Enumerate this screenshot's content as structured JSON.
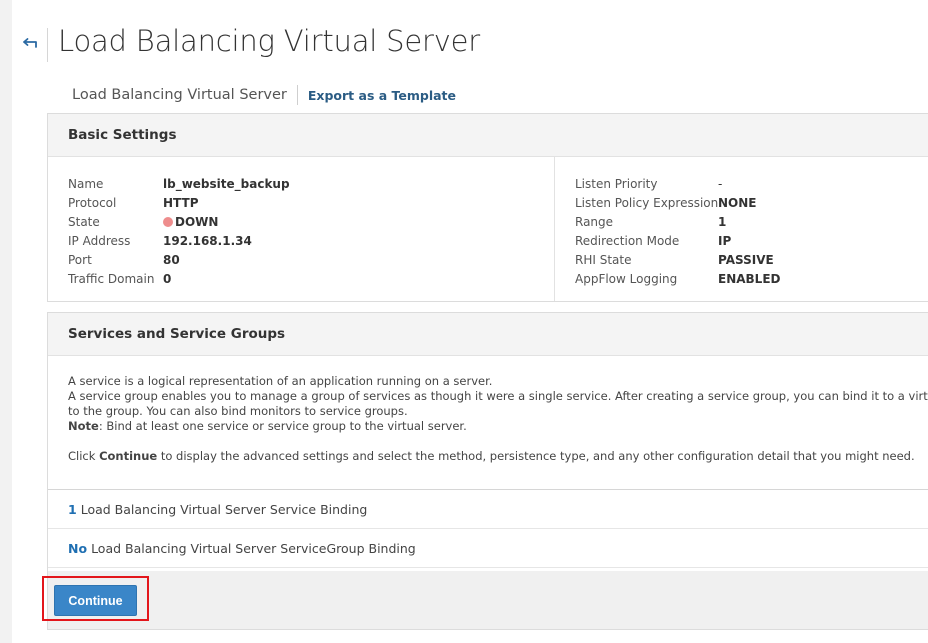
{
  "header": {
    "title": "Load Balancing Virtual Server"
  },
  "subheader": {
    "breadcrumb": "Load Balancing Virtual Server",
    "export_link": "Export as a Template"
  },
  "basic_settings": {
    "title": "Basic Settings",
    "left": [
      {
        "label": "Name",
        "value": "lb_website_backup"
      },
      {
        "label": "Protocol",
        "value": "HTTP"
      },
      {
        "label": "State",
        "value": "DOWN"
      },
      {
        "label": "IP Address",
        "value": "192.168.1.34"
      },
      {
        "label": "Port",
        "value": "80"
      },
      {
        "label": "Traffic Domain",
        "value": "0"
      }
    ],
    "right": [
      {
        "label": "Listen Priority",
        "value": "-"
      },
      {
        "label": "Listen Policy Expression",
        "value": "NONE"
      },
      {
        "label": "Range",
        "value": "1"
      },
      {
        "label": "Redirection Mode",
        "value": "IP"
      },
      {
        "label": "RHI State",
        "value": "PASSIVE"
      },
      {
        "label": "AppFlow Logging",
        "value": "ENABLED"
      }
    ],
    "state_color": "#ee8d8d"
  },
  "services": {
    "title": "Services and Service Groups",
    "desc_line1": "A service is a logical representation of an application running on a server.",
    "desc_line2": "A service group enables you to manage a group of services as though it were a single service. After creating a service group, you can bind it to a virtual server, and add services",
    "desc_line3": "to the group. You can also bind monitors to service groups.",
    "note_label": "Note",
    "note_text": ": Bind at least one service or service group to the virtual server.",
    "click_prefix": "Click ",
    "click_bold": "Continue",
    "click_suffix": " to display the advanced settings and select the method, persistence type, and any other configuration detail that you might need.",
    "bindings": [
      {
        "count": "1",
        "label": "Load Balancing Virtual Server Service Binding"
      },
      {
        "count": "No",
        "label": "Load Balancing Virtual Server ServiceGroup Binding"
      }
    ]
  },
  "actions": {
    "continue_label": "Continue"
  },
  "colors": {
    "accent": "#3a86c8",
    "link": "#2b5c84",
    "highlight": "#e3161b"
  }
}
